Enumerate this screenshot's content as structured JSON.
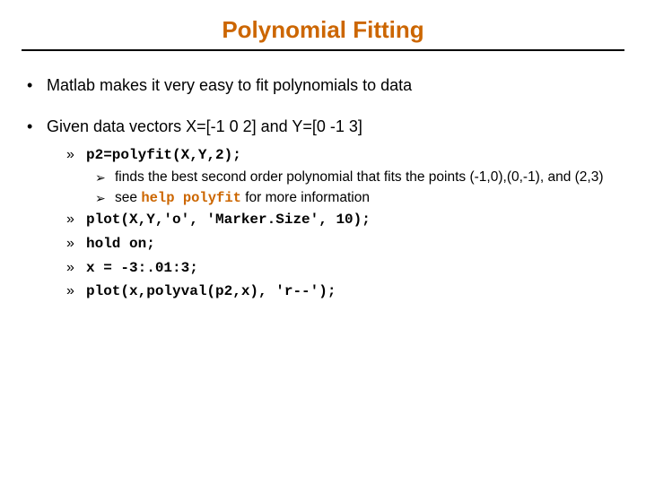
{
  "title": "Polynomial Fitting",
  "bullets": {
    "b1a": "Matlab makes it very easy to fit polynomials to data",
    "b1b": "Given data vectors X=[-1 0 2] and Y=[0 -1 3]",
    "b2a": "p2=polyfit(X,Y,2);",
    "b3a": "finds the best second order polynomial that fits the points (-1,0),(0,-1), and (2,3)",
    "b3b_pre": "see ",
    "b3b_kw": "help polyfit",
    "b3b_post": " for more information",
    "b2b": "plot(X,Y,'o', 'Marker.Size', 10);",
    "b2c": "hold on;",
    "b2d": "x = -3:.01:3;",
    "b2e": "plot(x,polyval(p2,x), 'r--');"
  }
}
